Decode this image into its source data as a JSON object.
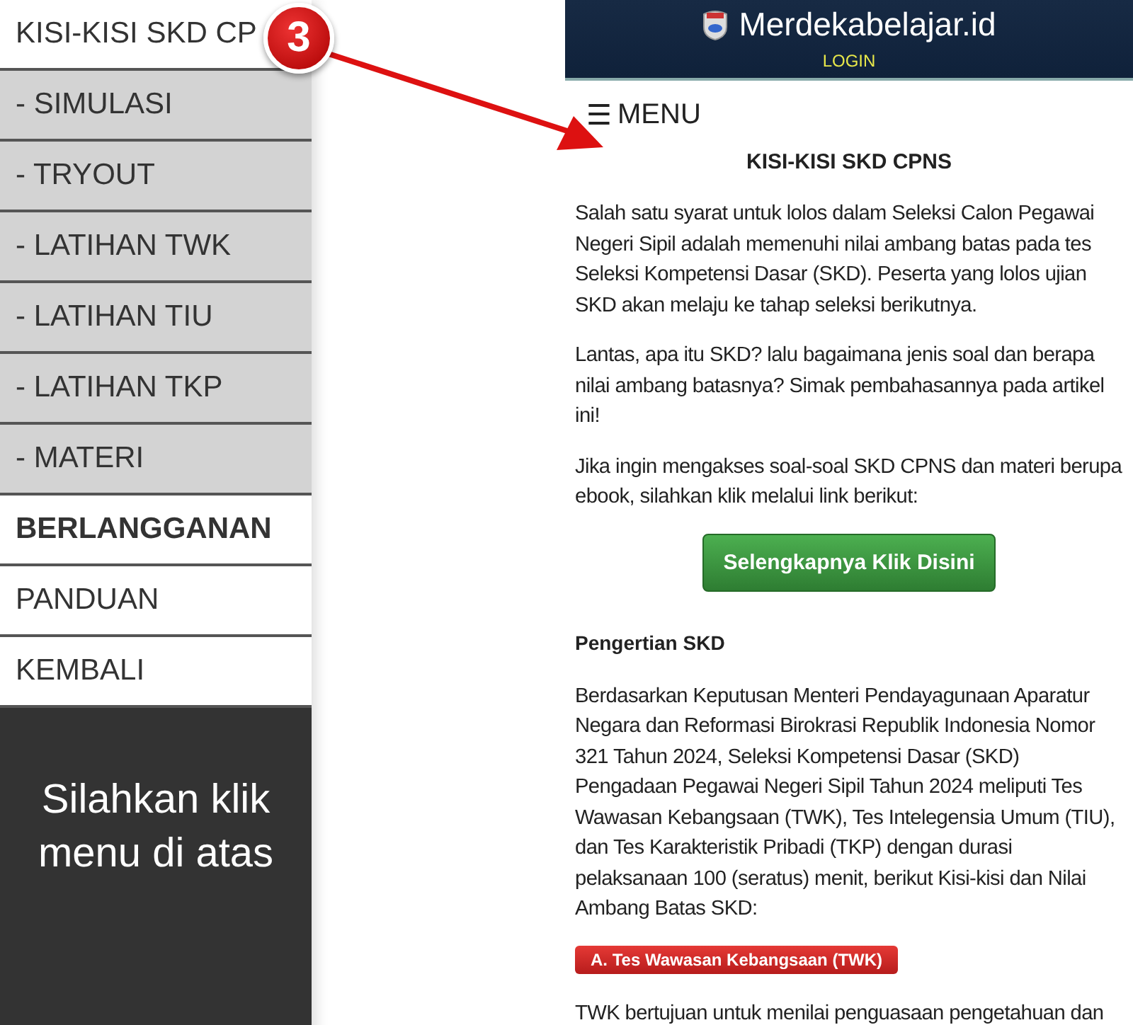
{
  "sidebar": {
    "items": [
      {
        "label": "KISI-KISI SKD CP",
        "kind": "main"
      },
      {
        "label": "- SIMULASI",
        "kind": "sub"
      },
      {
        "label": "- TRYOUT",
        "kind": "sub"
      },
      {
        "label": "- LATIHAN TWK",
        "kind": "sub"
      },
      {
        "label": "- LATIHAN TIU",
        "kind": "sub"
      },
      {
        "label": "- LATIHAN TKP",
        "kind": "sub"
      },
      {
        "label": "- MATERI",
        "kind": "sub"
      },
      {
        "label": "BERLANGGANAN",
        "kind": "heading"
      },
      {
        "label": "PANDUAN",
        "kind": "main"
      },
      {
        "label": "KEMBALI",
        "kind": "main"
      }
    ],
    "note": "Silahkan klik menu di atas"
  },
  "step_badge": "3",
  "site_header": {
    "title": "Merdekabelajar.id",
    "login": "LOGIN"
  },
  "menu_toggle": {
    "icon": "☰",
    "label": "MENU"
  },
  "article": {
    "title": "KISI-KISI SKD CPNS",
    "blocks": [
      {
        "kind": "paragraph",
        "text": "Salah satu syarat untuk lolos dalam Seleksi Calon Pegawai Negeri Sipil adalah memenuhi nilai ambang batas pada tes Seleksi Kompetensi Dasar (SKD). Peserta yang lolos ujian SKD akan melaju ke tahap seleksi berikutnya."
      },
      {
        "kind": "paragraph",
        "text": "Lantas, apa itu SKD? lalu bagaimana jenis soal dan berapa nilai ambang batasnya? Simak pembahasannya pada artikel ini!"
      },
      {
        "kind": "paragraph",
        "text": "Jika ingin mengakses soal-soal SKD CPNS dan materi berupa ebook, silahkan klik melalui link berikut:"
      },
      {
        "kind": "button",
        "text": "Selengkapnya Klik Disini"
      },
      {
        "kind": "heading",
        "text": "Pengertian SKD"
      },
      {
        "kind": "paragraph",
        "text": "Berdasarkan Keputusan Menteri Pendayagunaan Aparatur Negara dan Reformasi Birokrasi Republik Indonesia Nomor 321 Tahun 2024, Seleksi Kompetensi Dasar (SKD) Pengadaan Pegawai Negeri Sipil Tahun 2024 meliputi Tes Wawasan Kebangsaan (TWK), Tes Intelegensia Umum (TIU), dan Tes Karakteristik Pribadi (TKP) dengan durasi pelaksanaan 100 (seratus) menit, berikut Kisi-kisi dan Nilai Ambang Batas SKD:"
      },
      {
        "kind": "label",
        "text": "A. Tes Wawasan Kebangsaan (TWK)"
      },
      {
        "kind": "paragraph",
        "text": "TWK bertujuan untuk menilai penguasaan pengetahuan dan"
      }
    ]
  }
}
